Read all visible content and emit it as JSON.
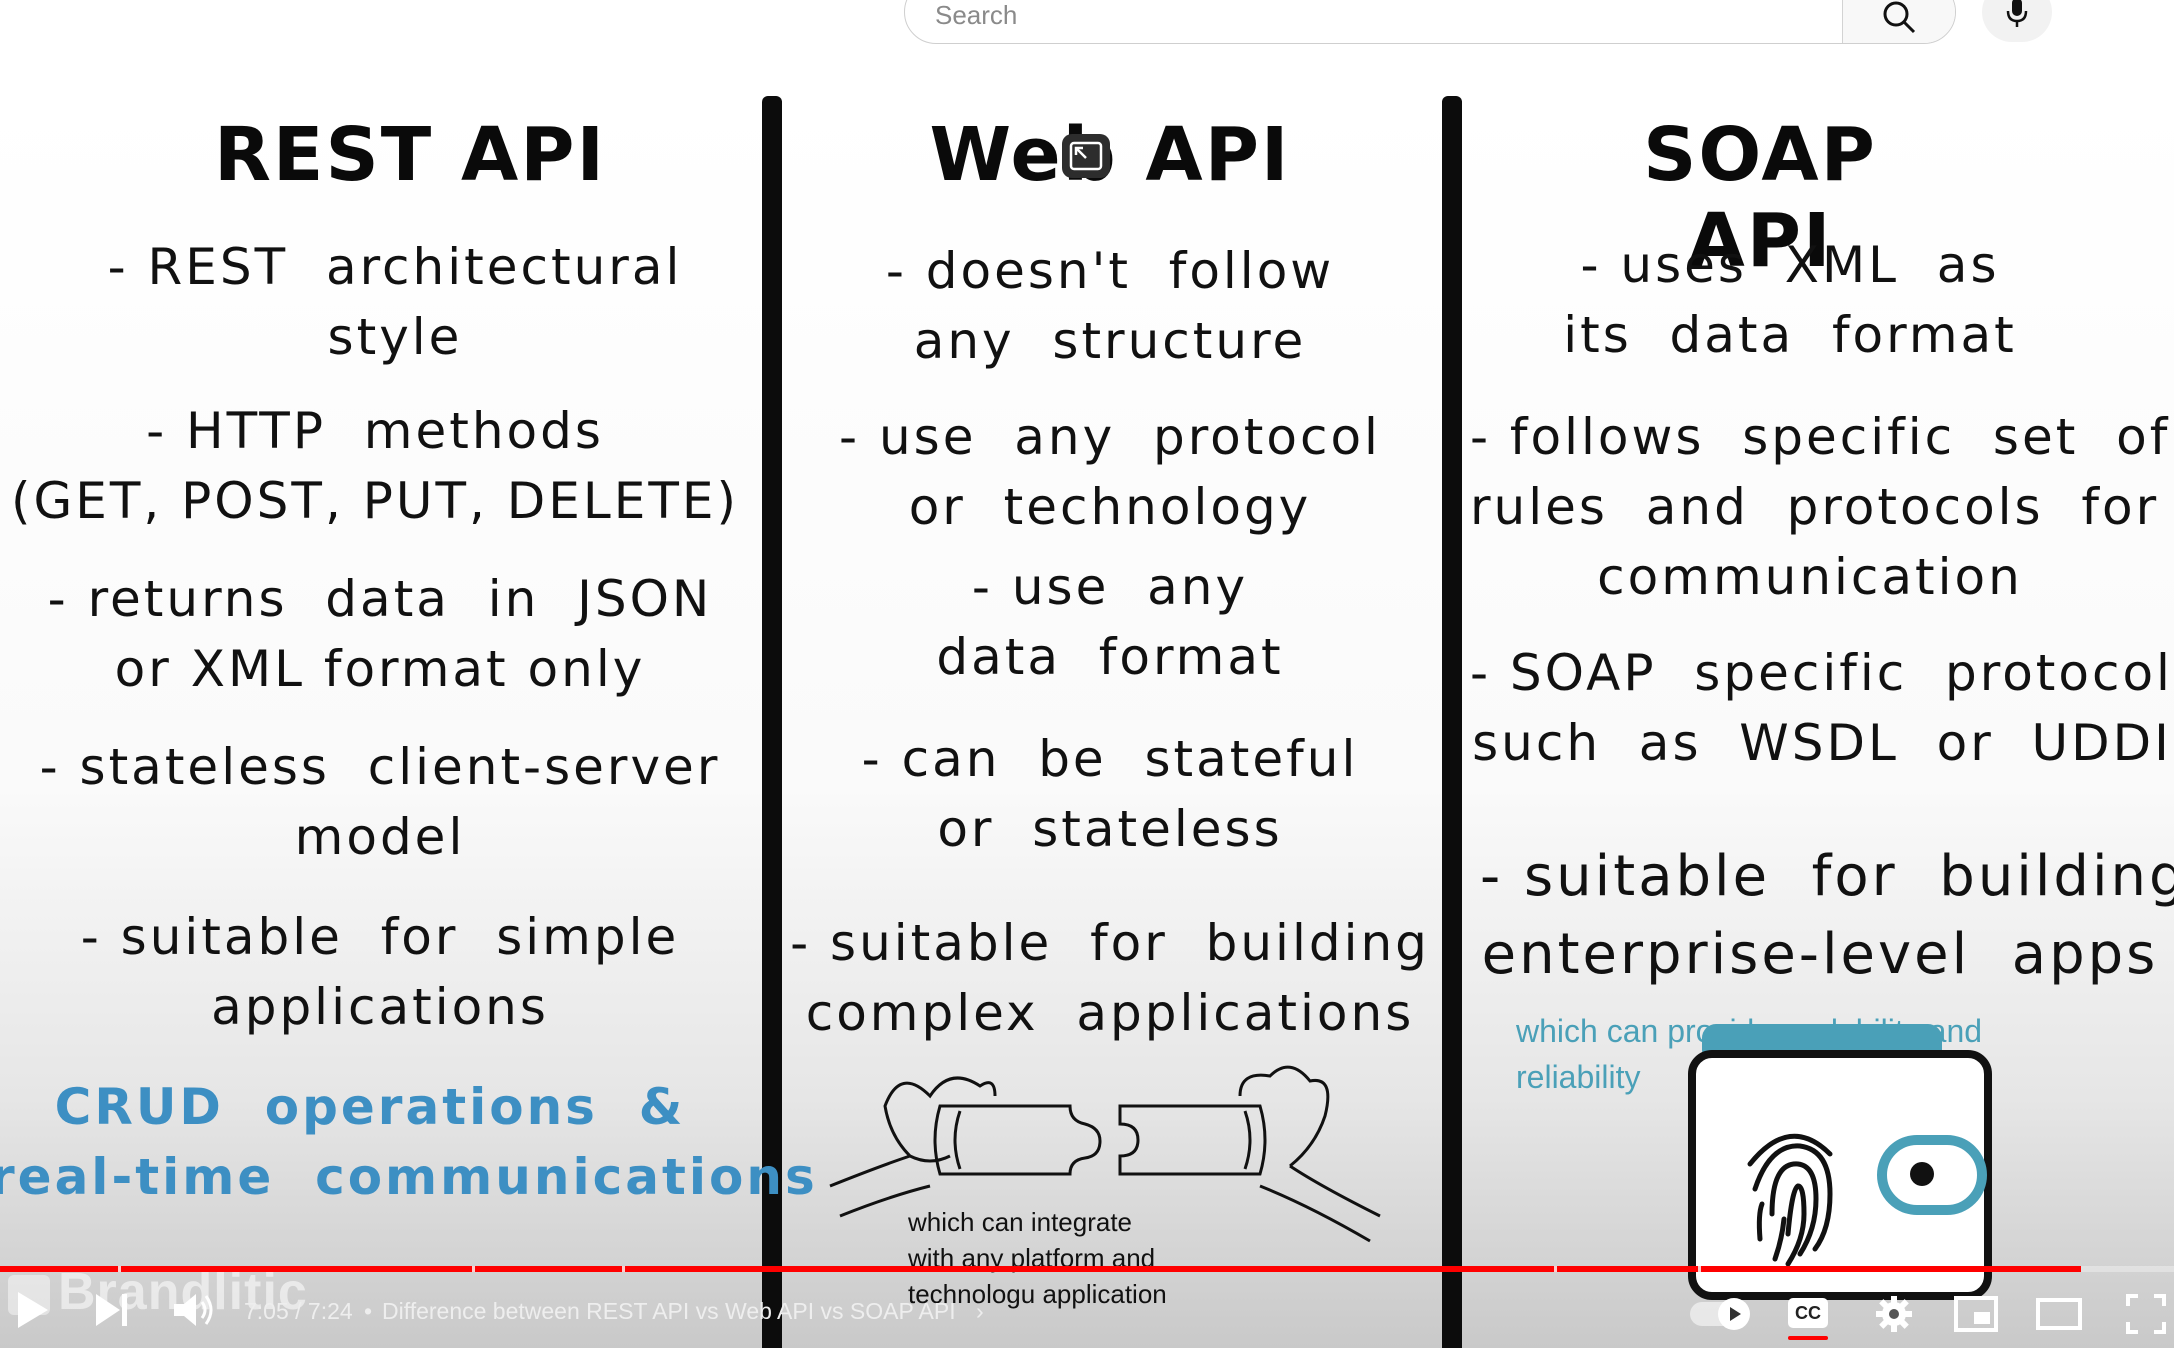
{
  "search": {
    "placeholder": "Search"
  },
  "slide": {
    "columns": [
      {
        "title": "REST API",
        "points": [
          "- REST  architectural\nstyle",
          "- HTTP  methods\n(GET, POST, PUT, DELETE)",
          "- returns  data  in  JSON\nor XML format only",
          "- stateless  client-server\nmodel",
          "- suitable  for  simple\napplications"
        ],
        "highlight": "CRUD  operations  &\nreal-time  communications"
      },
      {
        "title": "Web API",
        "points": [
          "- doesn't  follow\nany  structure",
          "- use  any  protocol\nor  technology",
          "- use  any\ndata  format",
          "- can  be  stateful\nor  stateless",
          "- suitable  for  building\ncomplex  applications"
        ],
        "note": "which can integrate\nwith any platform and\ntechnologu application"
      },
      {
        "title": "SOAP API",
        "points": [
          "- uses  XML  as\nits  data  format",
          "- follows  specific  set  of\nrules  and  protocols  for\ncommunication",
          "- SOAP  specific  protocol,\nsuch  as  WSDL  or  UDDI",
          "- suitable  for  building\nenterprise-level  apps"
        ],
        "note": "which can provide scalability and\nreliability"
      }
    ],
    "watermark": "Brandlitic"
  },
  "player": {
    "time": "7:05 / 7:24",
    "separator": "•",
    "title": "Difference between REST API vs Web API vs SOAP API",
    "progress_fraction": 0.957,
    "accent_color": "#ff0000"
  }
}
